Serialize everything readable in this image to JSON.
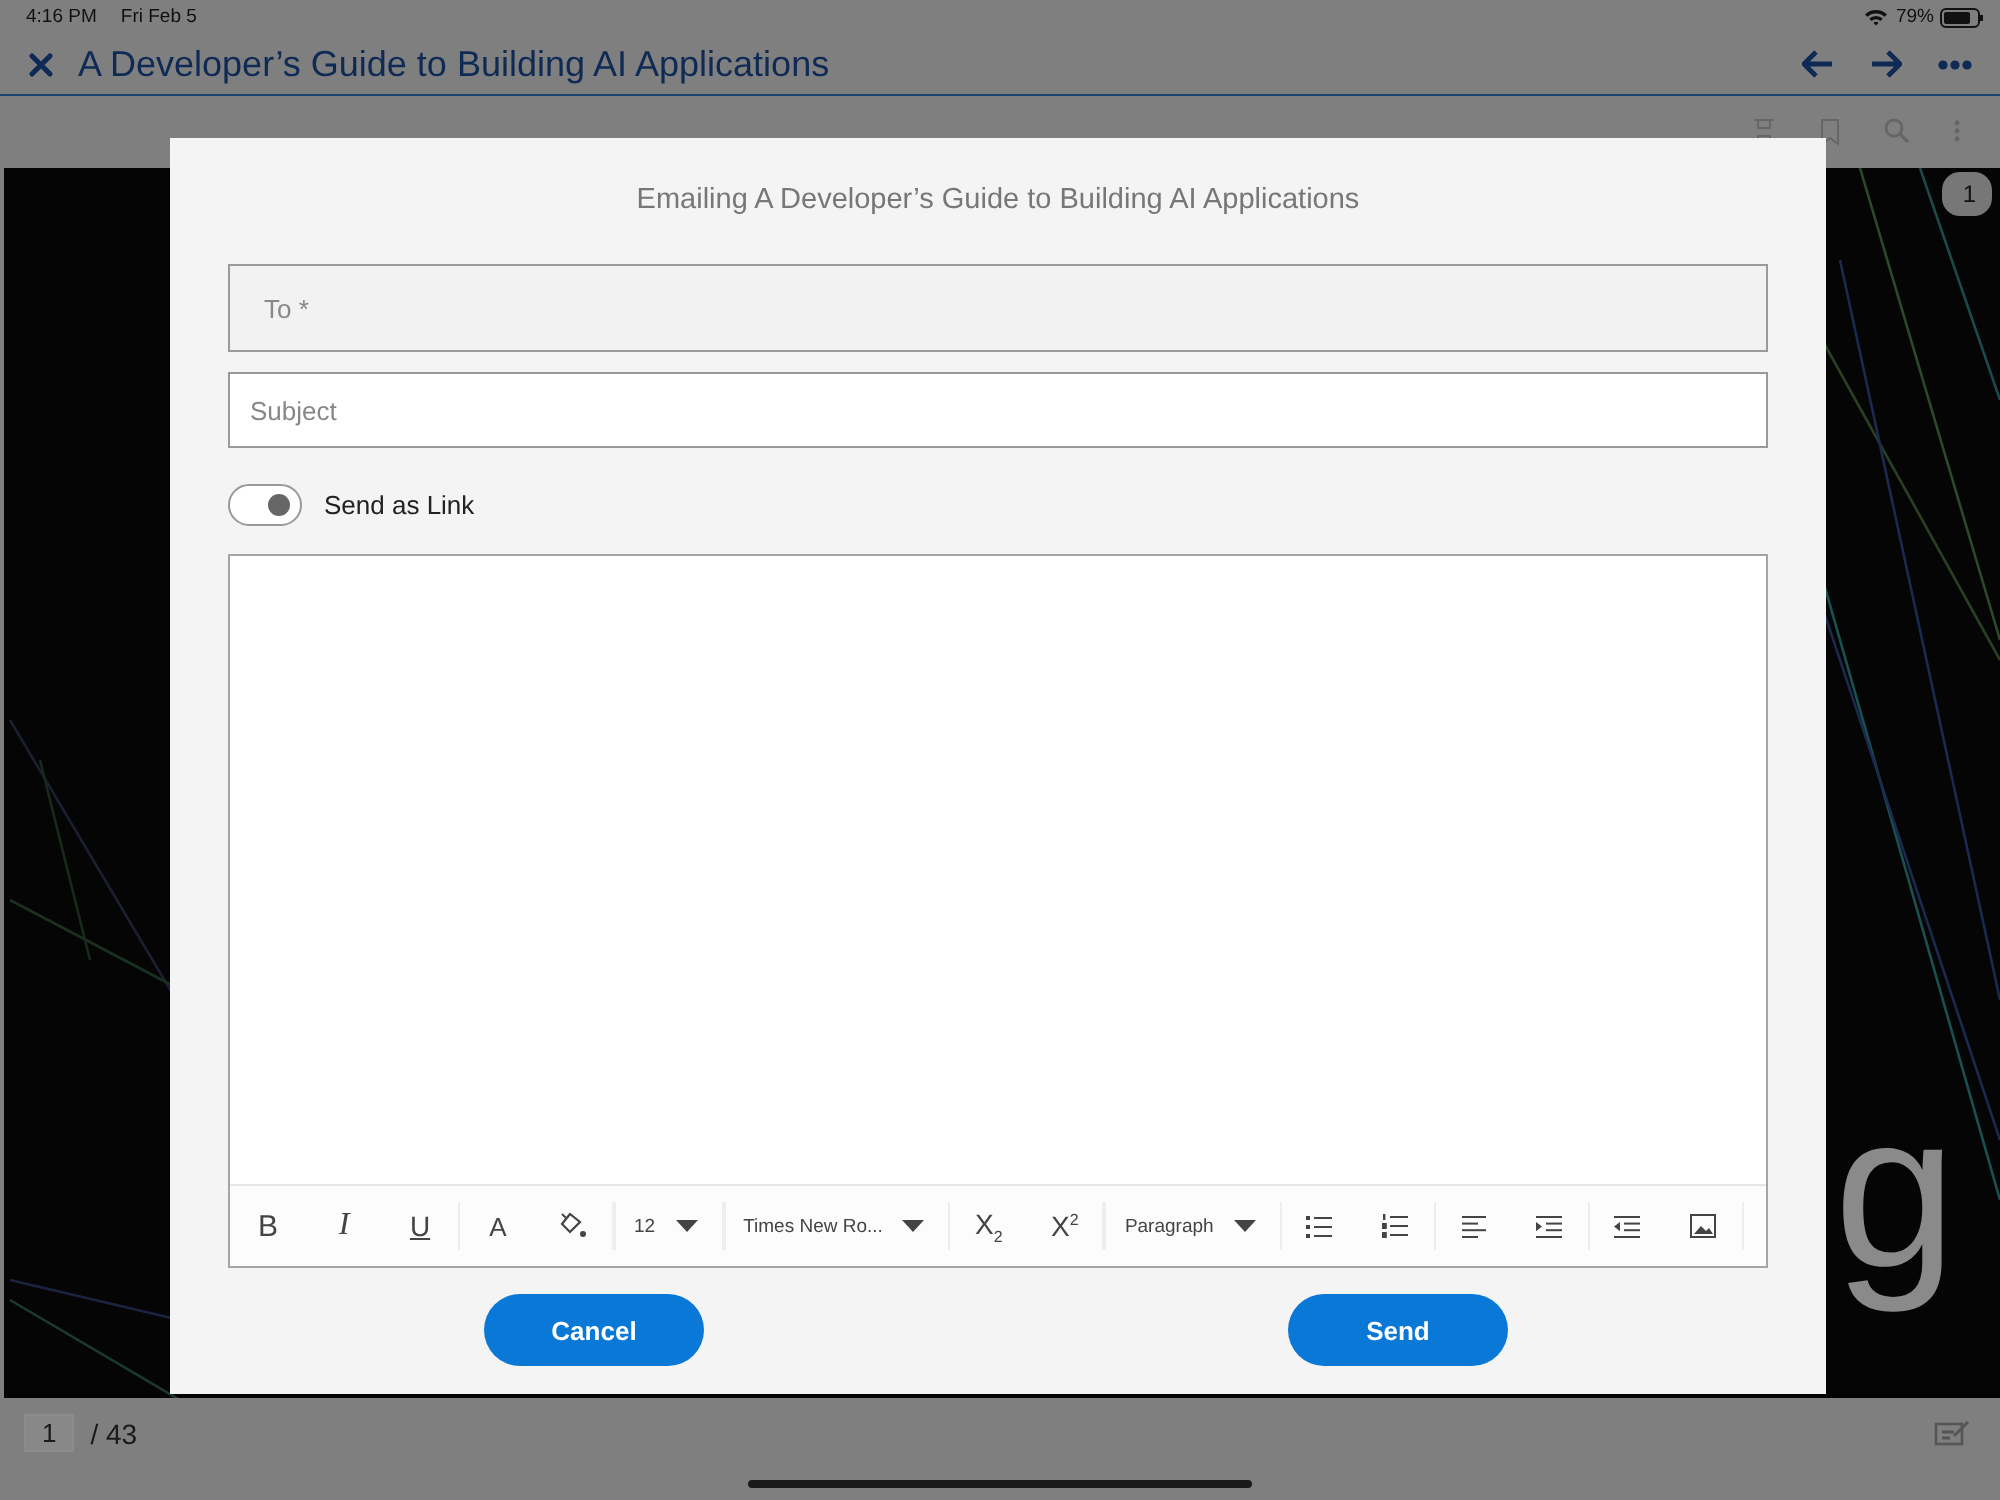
{
  "status_bar": {
    "time": "4:16 PM",
    "date": "Fri Feb 5",
    "battery": "79%"
  },
  "title_bar": {
    "title": "A Developer’s Guide to Building AI Applications"
  },
  "document": {
    "page_badge": "1",
    "visible_text": "g"
  },
  "dialog": {
    "title": "Emailing A Developer’s Guide to Building AI Applications",
    "to": {
      "placeholder": "To *"
    },
    "subject": {
      "placeholder": "Subject"
    },
    "send_as_link": {
      "label": "Send as Link",
      "on": true
    },
    "toolbar": [
      {
        "kind": "bold",
        "label": "B"
      },
      {
        "kind": "italic",
        "label": "I"
      },
      {
        "kind": "underline",
        "label": "U"
      },
      {
        "kind": "letter",
        "label": "A"
      },
      {
        "kind": "fill"
      },
      {
        "kind": "dropdown",
        "label": "12"
      },
      {
        "kind": "dropdown",
        "label": "Times New Ro..."
      },
      {
        "kind": "script",
        "label": "X$_{2}$"
      },
      {
        "kind": "script",
        "label": "X$^{2}$"
      },
      {
        "kind": "dropdown",
        "label": "Paragraph"
      },
      {
        "kind": "bullets"
      },
      {
        "kind": "numbers"
      },
      {
        "kind": "align"
      },
      {
        "kind": "indent"
      },
      {
        "kind": "outdent"
      },
      {
        "kind": "image"
      }
    ],
    "buttons": [
      {
        "label": "Cancel"
      },
      {
        "label": "Send"
      }
    ]
  },
  "footer": {
    "page": "1",
    "total": "/ 43"
  }
}
